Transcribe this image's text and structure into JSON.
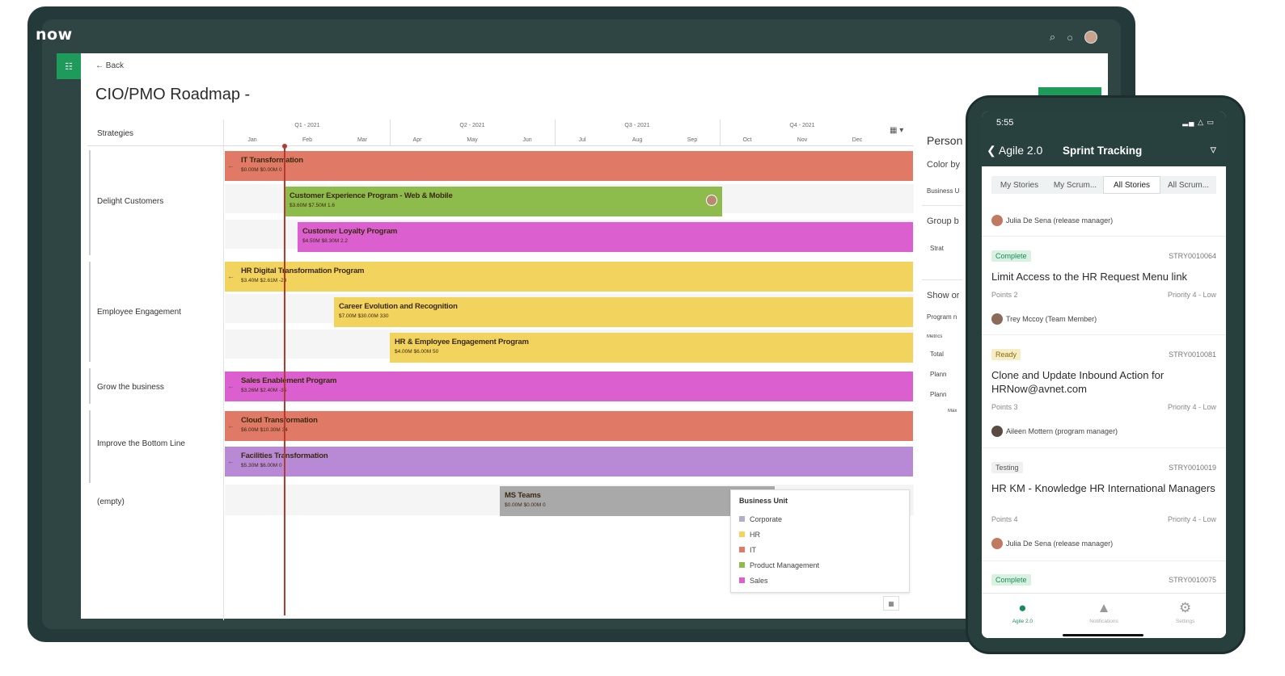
{
  "app": {
    "logo": "now",
    "page_title": "CIO/PMO Roadmap -",
    "back": "← Back"
  },
  "icons": {
    "search": "⌕",
    "bell": "○",
    "rail": "☷"
  },
  "gantt": {
    "strategies_header": "Strategies",
    "quarters": [
      "Q1 - 2021",
      "Q2 - 2021",
      "Q3 - 2021",
      "Q4 - 2021"
    ],
    "months": [
      "Jan",
      "Feb",
      "Mar",
      "Apr",
      "May",
      "Jun",
      "Jul",
      "Aug",
      "Sep",
      "Oct",
      "Nov",
      "Dec"
    ],
    "strategies": [
      "Delight Customers",
      "Employee Engagement",
      "Grow the business",
      "Improve the Bottom Line",
      "(empty)"
    ],
    "bars": [
      {
        "title": "IT Transformation",
        "meta": "$0.00M  $0.00M  0",
        "color": "#e07a66"
      },
      {
        "title": "Customer Experience Program - Web & Mobile",
        "meta": "$3.60M  $7.50M  1.6",
        "color": "#8dbb4c"
      },
      {
        "title": "Customer Loyalty Program",
        "meta": "$4.50M  $8.30M  2.2",
        "color": "#dc5fd0"
      },
      {
        "title": "HR Digital Transformation Program",
        "meta": "$3.40M  $2.61M  -23",
        "color": "#f2d35e"
      },
      {
        "title": "Career Evolution and Recognition",
        "meta": "$7.00M  $30.00M  330",
        "color": "#f2d35e"
      },
      {
        "title": "HR & Employee Engagement Program",
        "meta": "$4.00M  $6.00M  50",
        "color": "#f2d35e"
      },
      {
        "title": "Sales Enablement Program",
        "meta": "$3.26M  $2.40M  -35",
        "color": "#dc5fd0"
      },
      {
        "title": "Cloud Transformation",
        "meta": "$6.00M  $10.30M  34",
        "color": "#e07a66"
      },
      {
        "title": "Facilities Transformation",
        "meta": "$5.30M  $6.00M  0",
        "color": "#b88ad6"
      },
      {
        "title": "MS Teams",
        "meta": "$0.00M  $0.00M  0",
        "color": "#a9a9a9"
      }
    ],
    "legend": {
      "title": "Business Unit",
      "items": [
        {
          "label": "Corporate",
          "color": "#b0b0c8"
        },
        {
          "label": "HR",
          "color": "#f2d35e"
        },
        {
          "label": "IT",
          "color": "#e07a66"
        },
        {
          "label": "Product Management",
          "color": "#8dbb4c"
        },
        {
          "label": "Sales",
          "color": "#dc5fd0"
        }
      ]
    }
  },
  "right_panel": {
    "title": "Person",
    "color_by": "Color by",
    "business": "Business U",
    "group_by": "Group b",
    "strat": "Strat",
    "show": "Show or",
    "program": "Program n",
    "metrics": "Metrics",
    "total": "Total",
    "plan1": "Plann",
    "plan2": "Plann",
    "max": "Max"
  },
  "phone": {
    "time": "5:55",
    "signal": "▂▄ △ ▭",
    "back": "Agile 2.0",
    "title": "Sprint Tracking",
    "tabs": [
      "My Stories",
      "My Scrum...",
      "All Stories",
      "All Scrum..."
    ],
    "stories": [
      {
        "state": "Complete",
        "id": "STRY0010064",
        "title": "Limit Access to the HR Request Menu link",
        "points": "Points  2",
        "priority": "Priority  4 - Low",
        "assignee": "Trey Mccoy (Team Member)"
      },
      {
        "state": "Ready",
        "id": "STRY0010081",
        "title": "Clone and Update Inbound Action for HRNow@avnet.com",
        "points": "Points  3",
        "priority": "Priority  4 - Low",
        "assignee": "Aileen Mottern (program manager)"
      },
      {
        "state": "Testing",
        "id": "STRY0010019",
        "title": "HR KM - Knowledge HR International Managers",
        "points": "Points  4",
        "priority": "Priority  4 - Low",
        "assignee": "Julia De Sena (release manager)"
      },
      {
        "state": "Complete",
        "id": "STRY0010075"
      }
    ],
    "first_person": "Julia De Sena (release manager)",
    "nav": [
      {
        "icon": "●",
        "label": "Agile 2.0"
      },
      {
        "icon": "▲",
        "label": "Notifications"
      },
      {
        "icon": "⚙",
        "label": "Settings"
      }
    ]
  }
}
